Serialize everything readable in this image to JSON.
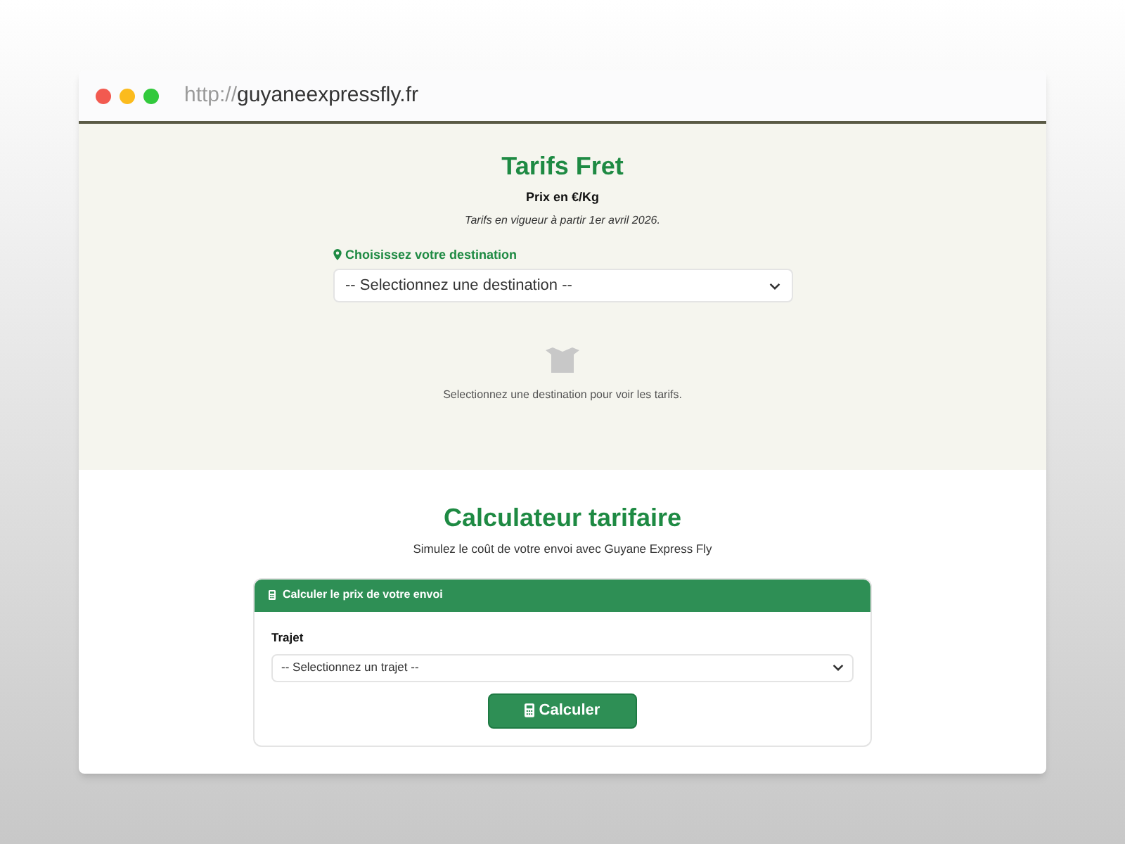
{
  "browser": {
    "scheme": "http://",
    "host": "guyaneexpressfly.fr"
  },
  "tarifs": {
    "title": "Tarifs Fret",
    "subtitle": "Prix en €/Kg",
    "note": "Tarifs en vigueur à partir 1er avril 2026.",
    "label": "Choisissez votre destination",
    "select": {
      "placeholder": "-- Selectionnez une destination --"
    },
    "empty_message": "Selectionnez une destination pour voir les tarifs."
  },
  "calculator": {
    "title": "Calculateur tarifaire",
    "subtitle": "Simulez le coût de votre envoi avec Guyane Express Fly",
    "card_title": "Calculer le prix de votre envoi",
    "field_label": "Trajet",
    "select": {
      "placeholder": "-- Selectionnez un trajet --"
    },
    "button": "Calculer"
  }
}
